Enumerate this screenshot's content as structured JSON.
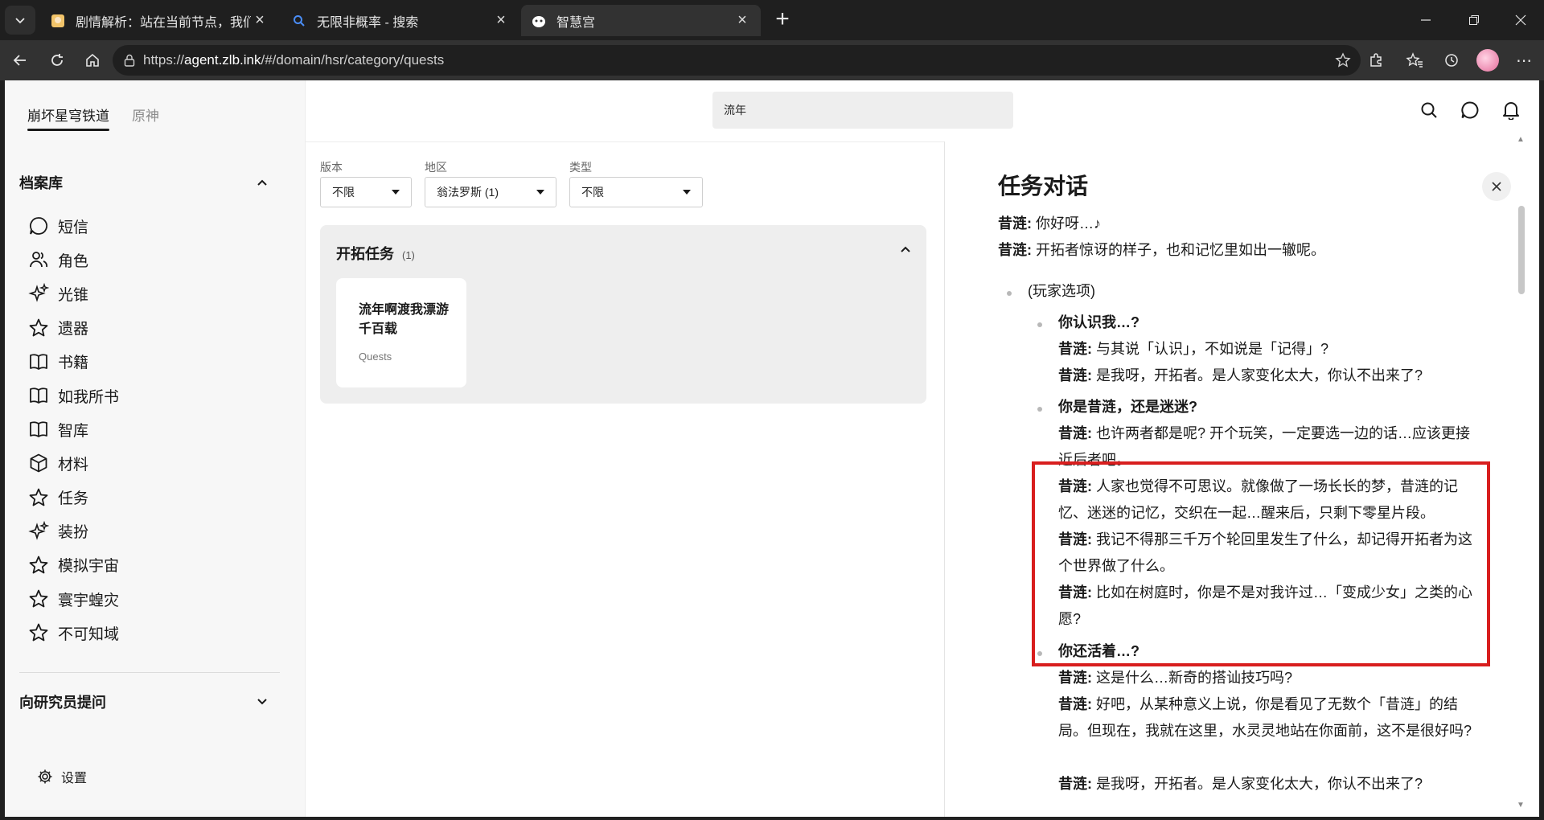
{
  "browser": {
    "tabs": [
      {
        "title": "剧情解析：站在当前节点，我们来"
      },
      {
        "title": "无限非概率 - 搜索"
      },
      {
        "title": "智慧宫"
      }
    ],
    "url": {
      "prefix": "https://",
      "host": "agent.zlb.ink",
      "path": "/#/domain/hsr/category/quests"
    }
  },
  "sidebar": {
    "game_tabs": [
      "崩坏星穹铁道",
      "原神"
    ],
    "archive_title": "档案库",
    "items": [
      {
        "label": "短信",
        "icon": "message-icon"
      },
      {
        "label": "角色",
        "icon": "people-icon"
      },
      {
        "label": "光锥",
        "icon": "sparkle-icon"
      },
      {
        "label": "遗器",
        "icon": "star-icon"
      },
      {
        "label": "书籍",
        "icon": "book-icon"
      },
      {
        "label": "如我所书",
        "icon": "book-icon"
      },
      {
        "label": "智库",
        "icon": "book-icon"
      },
      {
        "label": "材料",
        "icon": "cube-icon"
      },
      {
        "label": "任务",
        "icon": "star-icon"
      },
      {
        "label": "装扮",
        "icon": "sparkle-icon"
      },
      {
        "label": "模拟宇宙",
        "icon": "star-icon"
      },
      {
        "label": "寰宇蝗灾",
        "icon": "star-icon"
      },
      {
        "label": "不可知域",
        "icon": "star-icon"
      }
    ],
    "ask_title": "向研究员提问",
    "settings_label": "设置"
  },
  "header": {
    "search_value": "流年"
  },
  "filters": {
    "version": {
      "label": "版本",
      "value": "不限"
    },
    "region": {
      "label": "地区",
      "value": "翁法罗斯 (1)"
    },
    "type": {
      "label": "类型",
      "value": "不限"
    }
  },
  "group": {
    "title": "开拓任务",
    "count": "(1)",
    "card": {
      "title": "流年啊渡我漂游千百载",
      "subtitle": "Quests"
    }
  },
  "panel": {
    "title": "任务对话",
    "speaker": "昔涟:",
    "intro": [
      "你好呀…♪",
      "开拓者惊讶的样子，也和记忆里如出一辙呢。"
    ],
    "player_choice": "(玩家选项)",
    "options": [
      {
        "title": "你认识我…?",
        "lines": [
          "与其说「认识」，不如说是「记得」?",
          "是我呀，开拓者。是人家变化太大，你认不出来了?"
        ]
      },
      {
        "title": "你是昔涟，还是迷迷?",
        "lines": [
          "也许两者都是呢? 开个玩笑，一定要选一边的话…应该更接近后者吧。",
          "人家也觉得不可思议。就像做了一场长长的梦，昔涟的记忆、迷迷的记忆，交织在一起…醒来后，只剩下零星片段。",
          "我记不得那三千万个轮回里发生了什么，却记得开拓者为这个世界做了什么。",
          "比如在树庭时，你是不是对我许过…「变成少女」之类的心愿?"
        ]
      },
      {
        "title": "你还活着…?",
        "lines": [
          "这是什么…新奇的搭讪技巧吗?",
          "好吧，从某种意义上说，你是看见了无数个「昔涟」的结局。但现在，我就在这里，水灵灵地站在你面前，这不是很好吗?",
          "是我呀，开拓者。是人家变化太大，你认不出来了?"
        ]
      }
    ]
  }
}
